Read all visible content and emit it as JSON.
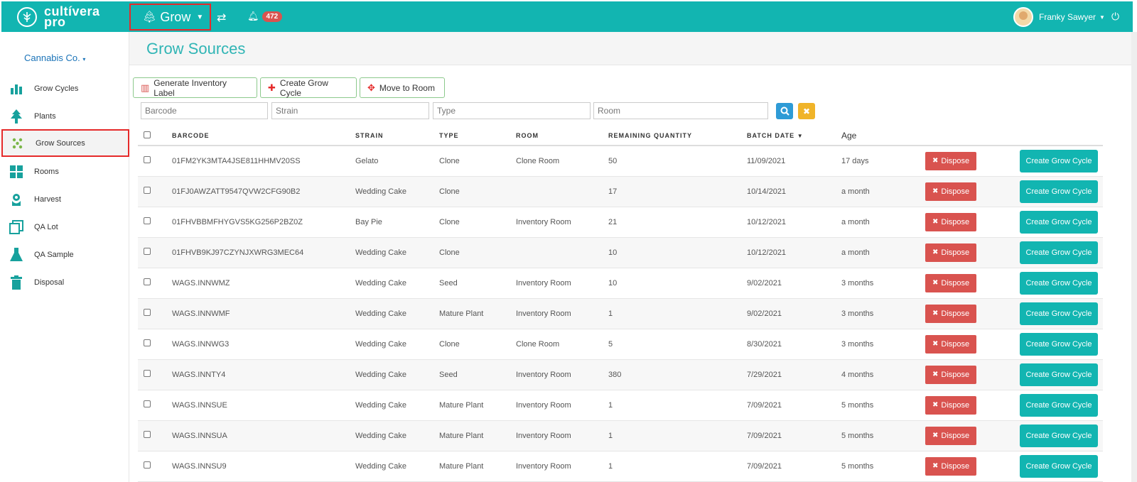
{
  "colors": {
    "brand": "#12b5b1",
    "danger": "#d9534f",
    "highlight": "#e52a2a",
    "title": "#30b5b5"
  },
  "header": {
    "logo_line1": "cultívera",
    "logo_line2": "pro",
    "module_label": "Grow",
    "notifications": "472",
    "user_name": "Franky Sawyer"
  },
  "sidebar": {
    "org": "Cannabis Co.",
    "items": [
      {
        "label": "Grow Cycles",
        "icon": "bar-chart-icon"
      },
      {
        "label": "Plants",
        "icon": "tree-icon"
      },
      {
        "label": "Grow Sources",
        "icon": "seeds-icon"
      },
      {
        "label": "Rooms",
        "icon": "grid-icon"
      },
      {
        "label": "Harvest",
        "icon": "flower-icon"
      },
      {
        "label": "QA Lot",
        "icon": "copy-icon"
      },
      {
        "label": "QA Sample",
        "icon": "flask-icon"
      },
      {
        "label": "Disposal",
        "icon": "trash-icon"
      }
    ]
  },
  "page": {
    "title": "Grow Sources",
    "actions": {
      "generate_label": "Generate Inventory Label",
      "create_cycle": "Create Grow Cycle",
      "move_room": "Move to Room"
    },
    "filters": {
      "barcode": "Barcode",
      "strain": "Strain",
      "type": "Type",
      "room": "Room"
    }
  },
  "table": {
    "headers": {
      "barcode": "BARCODE",
      "strain": "STRAIN",
      "type": "TYPE",
      "room": "ROOM",
      "remaining": "REMAINING QUANTITY",
      "batch_date": "BATCH DATE",
      "age": "Age"
    },
    "dispose_label": "Dispose",
    "create_label": "Create Grow Cycle",
    "rows": [
      {
        "barcode": "01FM2YK3MTA4JSE811HHMV20SS",
        "strain": "Gelato",
        "type": "Clone",
        "room": "Clone Room",
        "remaining": "50",
        "batch_date": "11/09/2021",
        "age": "17 days"
      },
      {
        "barcode": "01FJ0AWZATT9547QVW2CFG90B2",
        "strain": "Wedding Cake",
        "type": "Clone",
        "room": "",
        "remaining": "17",
        "batch_date": "10/14/2021",
        "age": "a month"
      },
      {
        "barcode": "01FHVBBMFHYGVS5KG256P2BZ0Z",
        "strain": "Bay Pie",
        "type": "Clone",
        "room": "Inventory Room",
        "remaining": "21",
        "batch_date": "10/12/2021",
        "age": "a month"
      },
      {
        "barcode": "01FHVB9KJ97CZYNJXWRG3MEC64",
        "strain": "Wedding Cake",
        "type": "Clone",
        "room": "",
        "remaining": "10",
        "batch_date": "10/12/2021",
        "age": "a month"
      },
      {
        "barcode": "WAGS.INNWMZ",
        "strain": "Wedding Cake",
        "type": "Seed",
        "room": "Inventory Room",
        "remaining": "10",
        "batch_date": "9/02/2021",
        "age": "3 months"
      },
      {
        "barcode": "WAGS.INNWMF",
        "strain": "Wedding Cake",
        "type": "Mature Plant",
        "room": "Inventory Room",
        "remaining": "1",
        "batch_date": "9/02/2021",
        "age": "3 months"
      },
      {
        "barcode": "WAGS.INNWG3",
        "strain": "Wedding Cake",
        "type": "Clone",
        "room": "Clone Room",
        "remaining": "5",
        "batch_date": "8/30/2021",
        "age": "3 months"
      },
      {
        "barcode": "WAGS.INNTY4",
        "strain": "Wedding Cake",
        "type": "Seed",
        "room": "Inventory Room",
        "remaining": "380",
        "batch_date": "7/29/2021",
        "age": "4 months"
      },
      {
        "barcode": "WAGS.INNSUE",
        "strain": "Wedding Cake",
        "type": "Mature Plant",
        "room": "Inventory Room",
        "remaining": "1",
        "batch_date": "7/09/2021",
        "age": "5 months"
      },
      {
        "barcode": "WAGS.INNSUA",
        "strain": "Wedding Cake",
        "type": "Mature Plant",
        "room": "Inventory Room",
        "remaining": "1",
        "batch_date": "7/09/2021",
        "age": "5 months"
      },
      {
        "barcode": "WAGS.INNSU9",
        "strain": "Wedding Cake",
        "type": "Mature Plant",
        "room": "Inventory Room",
        "remaining": "1",
        "batch_date": "7/09/2021",
        "age": "5 months"
      }
    ]
  }
}
